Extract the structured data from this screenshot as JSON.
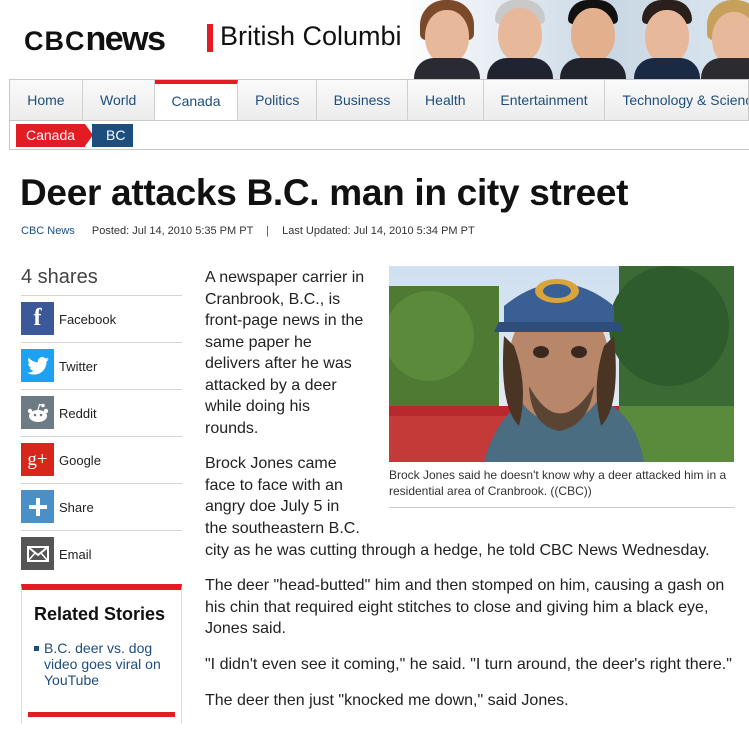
{
  "header": {
    "logo_cbc": "CBC",
    "logo_news": "news",
    "region": "British Columbia"
  },
  "nav": {
    "items": [
      "Home",
      "World",
      "Canada",
      "Politics",
      "Business",
      "Health",
      "Entertainment",
      "Technology & Science"
    ],
    "active": "Canada"
  },
  "breadcrumb": {
    "items": [
      "Canada",
      "BC"
    ]
  },
  "article": {
    "headline": "Deer attacks B.C. man in city street",
    "source": "CBC News",
    "posted": "Posted: Jul 14, 2010 5:35 PM PT",
    "separator": "|",
    "updated": "Last Updated: Jul 14, 2010 5:34 PM PT",
    "p1": [
      "A newspaper carrier in",
      "Cranbrook, B.C., is",
      "front-page news in the",
      "same paper he",
      "delivers after he was",
      "attacked by a deer",
      "while doing his",
      "rounds."
    ],
    "p2": [
      "Brock Jones came",
      "face to face with an",
      "angry doe July 5 in",
      "the southeastern B.C."
    ],
    "p2_tail": "city as he was cutting through a hedge, he told CBC News Wednesday.",
    "p3": [
      "The deer \"head-butted\" him and then stomped on him, causing a gash on",
      "his chin that required eight stitches to close and giving him a black eye,",
      "Jones said."
    ],
    "p4": "\"I didn't even see it coming,\" he said. \"I turn around, the deer's right there.\"",
    "p5": "The deer then just \"knocked me down,\" said Jones.",
    "caption": "Brock Jones said he doesn't know why a deer attacked him in a residential area of Cranbrook. ((CBC))"
  },
  "share": {
    "count": "4 shares",
    "items": [
      {
        "label": "Facebook",
        "icon": "facebook-icon",
        "color": "#3b5998"
      },
      {
        "label": "Twitter",
        "icon": "twitter-icon",
        "color": "#1da1f2"
      },
      {
        "label": "Reddit",
        "icon": "reddit-icon",
        "color": "#6d7b84"
      },
      {
        "label": "Google",
        "icon": "google-plus-icon",
        "color": "#d7271a"
      },
      {
        "label": "Share",
        "icon": "plus-icon",
        "color": "#4a90c7"
      },
      {
        "label": "Email",
        "icon": "email-icon",
        "color": "#555555"
      }
    ]
  },
  "related": {
    "title": "Related Stories",
    "items": [
      "B.C. deer vs. dog video goes viral on YouTube"
    ]
  },
  "colors": {
    "accent": "#e31b23",
    "link": "#1d4e7d"
  }
}
